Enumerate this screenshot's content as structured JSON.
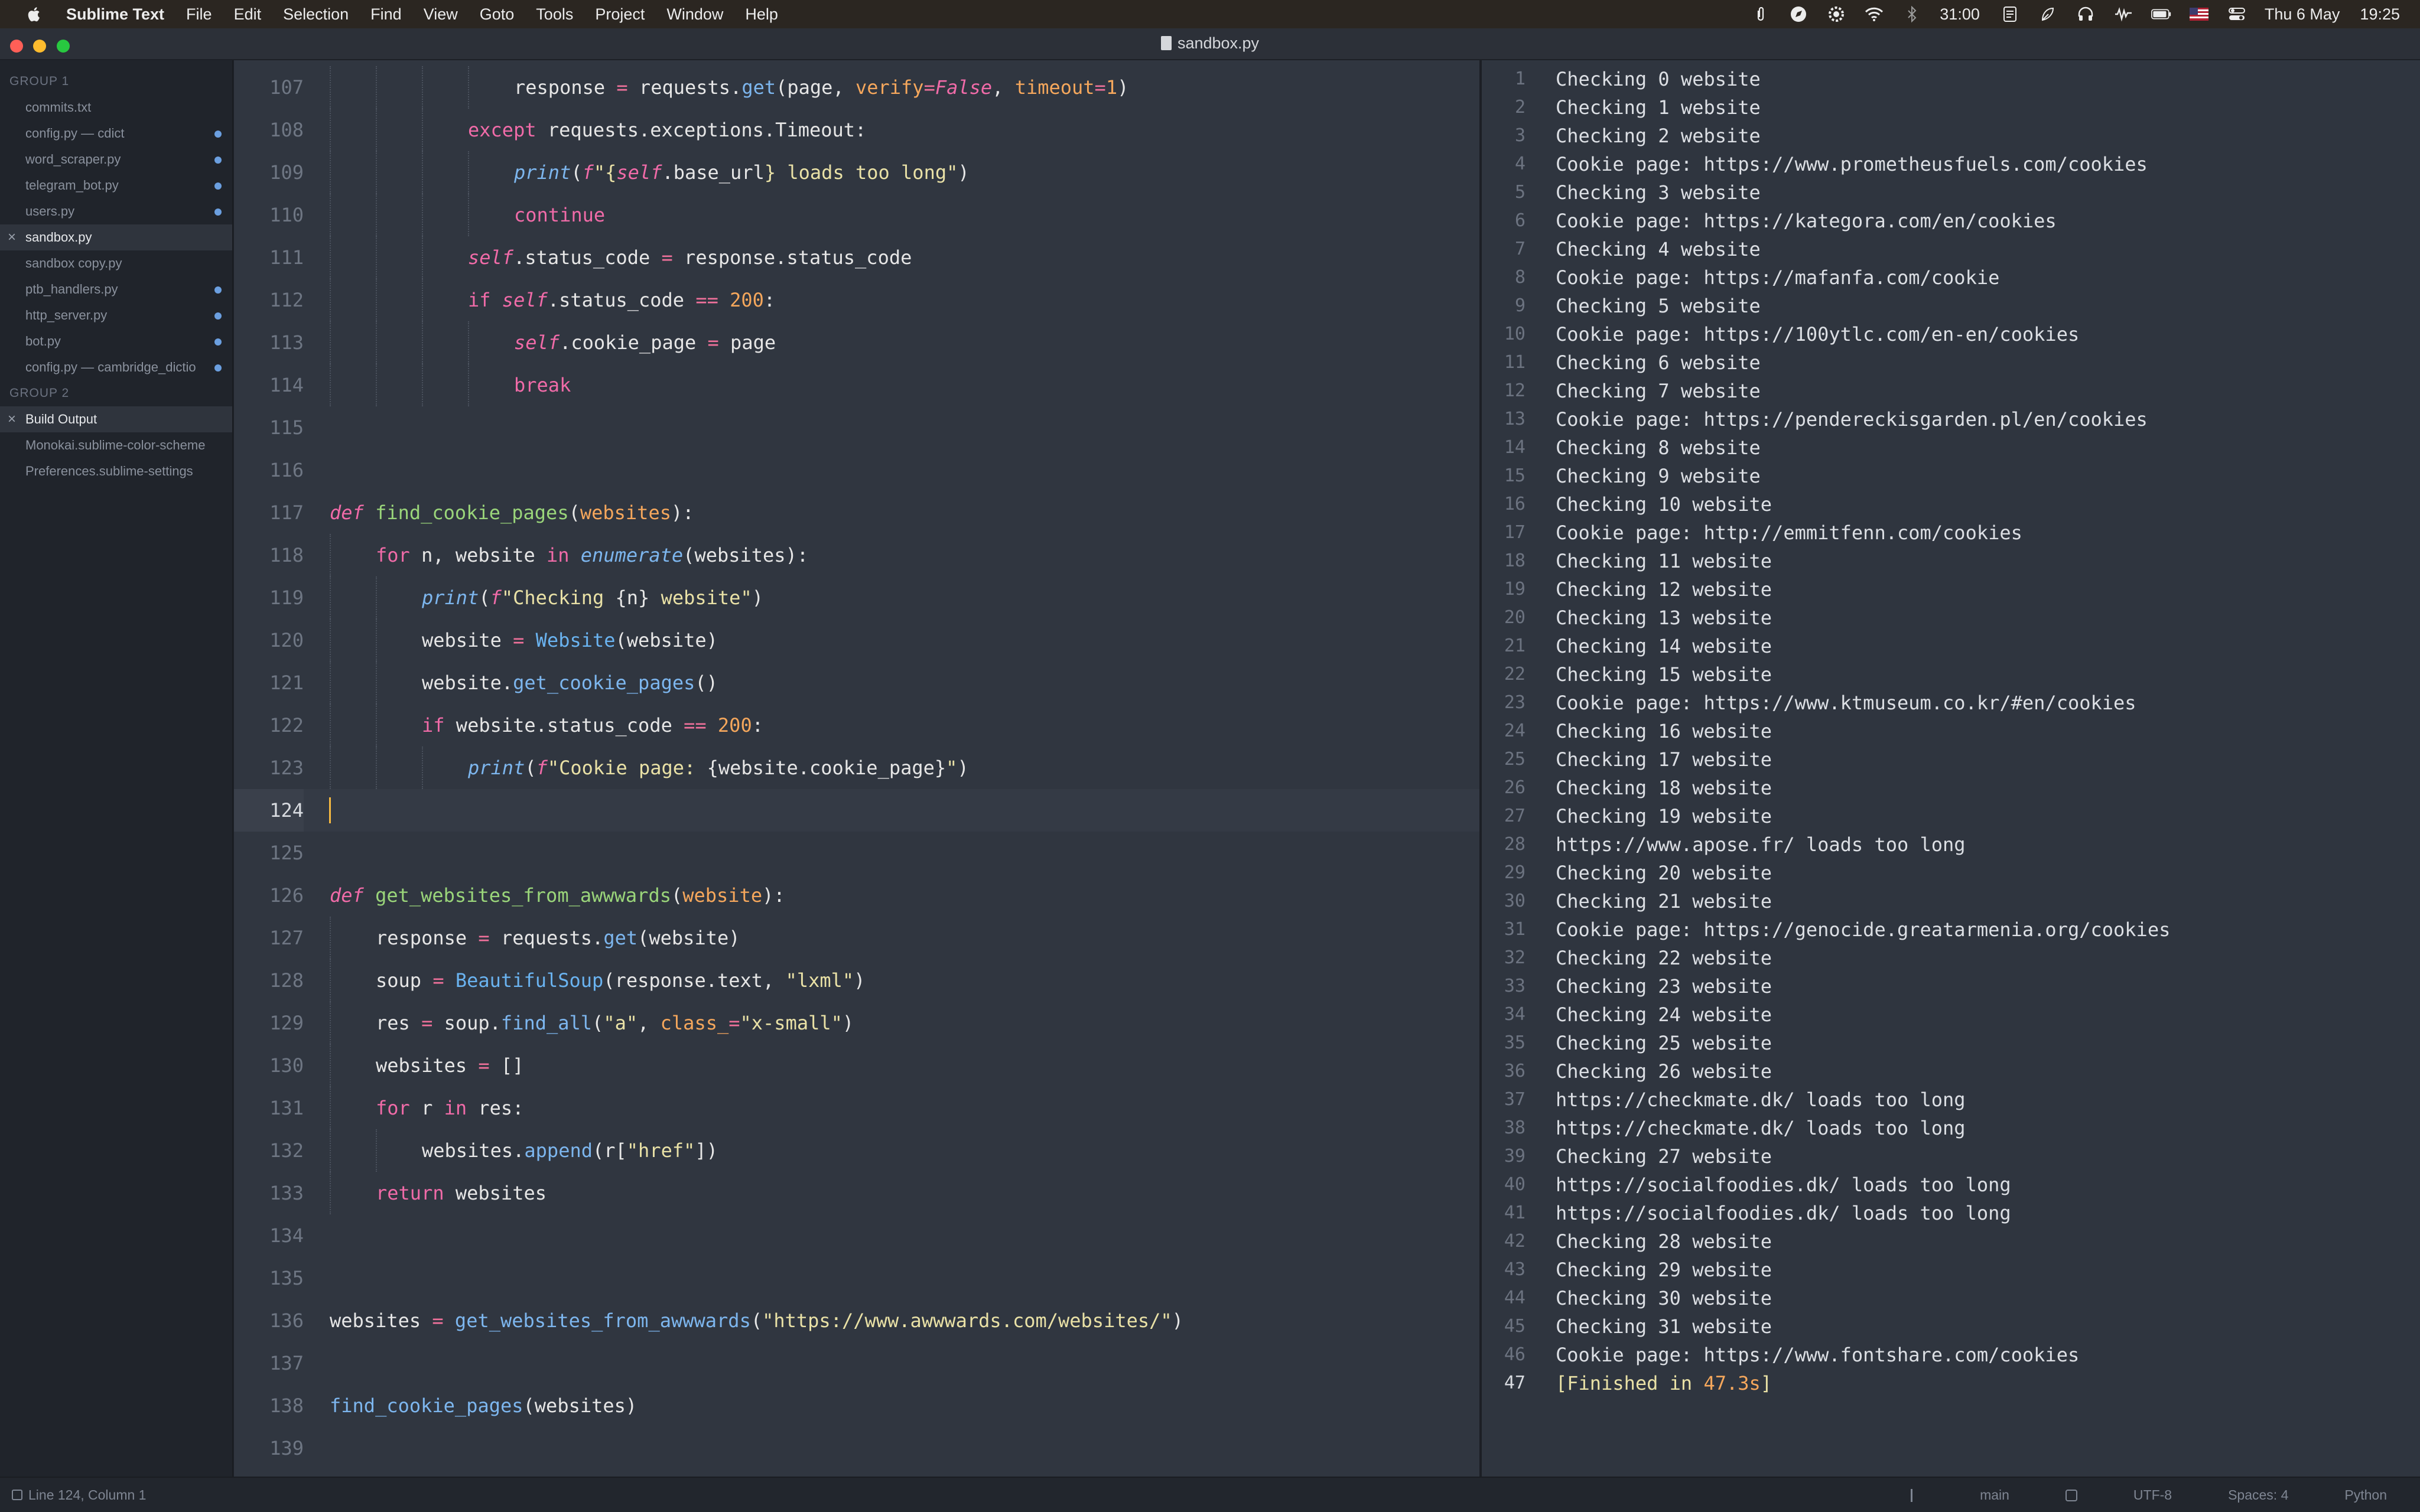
{
  "menubar": {
    "app_name": "Sublime Text",
    "menus": [
      "File",
      "Edit",
      "Selection",
      "Find",
      "View",
      "Goto",
      "Tools",
      "Project",
      "Window",
      "Help"
    ],
    "timer": "31:00",
    "date": "Thu 6 May",
    "time": "19:25",
    "status_icons": [
      "paperclip-icon",
      "compass-icon",
      "gear-badge-icon",
      "wifi-icon",
      "bluetooth-icon",
      "timer-icon",
      "notes-icon",
      "leaf-icon",
      "headphones-icon",
      "waveform-icon",
      "battery-icon",
      "flag-icon",
      "control-center-icon"
    ]
  },
  "window": {
    "title": "sandbox.py"
  },
  "sidebar": {
    "group1_label": "GROUP 1",
    "group1_items": [
      {
        "label": "commits.txt",
        "dot": false,
        "active": false,
        "closable": false
      },
      {
        "label": "config.py — cdict",
        "dot": true,
        "active": false,
        "closable": false
      },
      {
        "label": "word_scraper.py",
        "dot": true,
        "active": false,
        "closable": false
      },
      {
        "label": "telegram_bot.py",
        "dot": true,
        "active": false,
        "closable": false
      },
      {
        "label": "users.py",
        "dot": true,
        "active": false,
        "closable": false
      },
      {
        "label": "sandbox.py",
        "dot": false,
        "active": true,
        "closable": true
      },
      {
        "label": "sandbox copy.py",
        "dot": false,
        "active": false,
        "closable": false
      },
      {
        "label": "ptb_handlers.py",
        "dot": true,
        "active": false,
        "closable": false
      },
      {
        "label": "http_server.py",
        "dot": true,
        "active": false,
        "closable": false
      },
      {
        "label": "bot.py",
        "dot": true,
        "active": false,
        "closable": false
      },
      {
        "label": "config.py — cambridge_dictio",
        "dot": true,
        "active": false,
        "closable": false
      }
    ],
    "group2_label": "GROUP 2",
    "group2_items": [
      {
        "label": "Build Output",
        "dot": false,
        "active": true,
        "closable": true
      },
      {
        "label": "Monokai.sublime-color-scheme",
        "dot": false,
        "active": false,
        "closable": false
      },
      {
        "label": "Preferences.sublime-settings",
        "dot": false,
        "active": false,
        "closable": false
      }
    ]
  },
  "editor": {
    "current_line": 124,
    "lines": [
      {
        "n": "107",
        "indent": 4,
        "tokens": [
          [
            "pl",
            "response "
          ],
          [
            "op",
            "="
          ],
          [
            "pl",
            " requests."
          ],
          [
            "ac",
            "get"
          ],
          [
            "pl",
            "(page, "
          ],
          [
            "pm",
            "verify"
          ],
          [
            "op",
            "="
          ],
          [
            "fal",
            "False"
          ],
          [
            "pl",
            ", "
          ],
          [
            "pm",
            "timeout"
          ],
          [
            "op",
            "="
          ],
          [
            "num",
            "1"
          ],
          [
            "pl",
            ")"
          ]
        ]
      },
      {
        "n": "108",
        "indent": 3,
        "tokens": [
          [
            "kw",
            "except"
          ],
          [
            "pl",
            " requests.exceptions.Timeout:"
          ]
        ]
      },
      {
        "n": "109",
        "indent": 4,
        "tokens": [
          [
            "bii",
            "print"
          ],
          [
            "pl",
            "("
          ],
          [
            "kwi",
            "f"
          ],
          [
            "st",
            "\"{"
          ],
          [
            "sf",
            "self"
          ],
          [
            "pl",
            ".base_url"
          ],
          [
            "st",
            "} loads too long\""
          ],
          [
            "pl",
            ")"
          ]
        ]
      },
      {
        "n": "110",
        "indent": 4,
        "tokens": [
          [
            "kw",
            "continue"
          ]
        ]
      },
      {
        "n": "111",
        "indent": 3,
        "tokens": [
          [
            "sf",
            "self"
          ],
          [
            "pl",
            ".status_code "
          ],
          [
            "op",
            "="
          ],
          [
            "pl",
            " response.status_code"
          ]
        ]
      },
      {
        "n": "112",
        "indent": 3,
        "tokens": [
          [
            "kw",
            "if "
          ],
          [
            "sf",
            "self"
          ],
          [
            "pl",
            ".status_code "
          ],
          [
            "op",
            "=="
          ],
          [
            "pl",
            " "
          ],
          [
            "num",
            "200"
          ],
          [
            "pl",
            ":"
          ]
        ]
      },
      {
        "n": "113",
        "indent": 4,
        "tokens": [
          [
            "sf",
            "self"
          ],
          [
            "pl",
            ".cookie_page "
          ],
          [
            "op",
            "="
          ],
          [
            "pl",
            " page"
          ]
        ]
      },
      {
        "n": "114",
        "indent": 4,
        "tokens": [
          [
            "kw",
            "break"
          ]
        ]
      },
      {
        "n": "115",
        "indent": 0,
        "tokens": []
      },
      {
        "n": "116",
        "indent": 0,
        "tokens": []
      },
      {
        "n": "117",
        "indent": 0,
        "tokens": [
          [
            "kwi",
            "def"
          ],
          [
            "pl",
            " "
          ],
          [
            "fn",
            "find_cookie_pages"
          ],
          [
            "pl",
            "("
          ],
          [
            "pm",
            "websites"
          ],
          [
            "pl",
            "):"
          ]
        ]
      },
      {
        "n": "118",
        "indent": 1,
        "tokens": [
          [
            "kw",
            "for"
          ],
          [
            "pl",
            " n, website "
          ],
          [
            "kw",
            "in"
          ],
          [
            "pl",
            " "
          ],
          [
            "bii",
            "enumerate"
          ],
          [
            "pl",
            "(websites):"
          ]
        ]
      },
      {
        "n": "119",
        "indent": 2,
        "tokens": [
          [
            "bii",
            "print"
          ],
          [
            "pl",
            "("
          ],
          [
            "kwi",
            "f"
          ],
          [
            "st",
            "\"Checking "
          ],
          [
            "pl",
            "{n}"
          ],
          [
            "st",
            " website\""
          ],
          [
            "pl",
            ")"
          ]
        ]
      },
      {
        "n": "120",
        "indent": 2,
        "tokens": [
          [
            "pl",
            "website "
          ],
          [
            "op",
            "="
          ],
          [
            "pl",
            " "
          ],
          [
            "cls",
            "Website"
          ],
          [
            "pl",
            "(website)"
          ]
        ]
      },
      {
        "n": "121",
        "indent": 2,
        "tokens": [
          [
            "pl",
            "website."
          ],
          [
            "ac",
            "get_cookie_pages"
          ],
          [
            "pl",
            "()"
          ]
        ]
      },
      {
        "n": "122",
        "indent": 2,
        "tokens": [
          [
            "kw",
            "if"
          ],
          [
            "pl",
            " website.status_code "
          ],
          [
            "op",
            "=="
          ],
          [
            "pl",
            " "
          ],
          [
            "num",
            "200"
          ],
          [
            "pl",
            ":"
          ]
        ]
      },
      {
        "n": "123",
        "indent": 3,
        "tokens": [
          [
            "bii",
            "print"
          ],
          [
            "pl",
            "("
          ],
          [
            "kwi",
            "f"
          ],
          [
            "st",
            "\"Cookie page: "
          ],
          [
            "pl",
            "{website.cookie_page}"
          ],
          [
            "st",
            "\""
          ],
          [
            "pl",
            ")"
          ]
        ]
      },
      {
        "n": "124",
        "indent": 0,
        "tokens": [],
        "current": true
      },
      {
        "n": "125",
        "indent": 0,
        "tokens": []
      },
      {
        "n": "126",
        "indent": 0,
        "tokens": [
          [
            "kwi",
            "def"
          ],
          [
            "pl",
            " "
          ],
          [
            "fn",
            "get_websites_from_awwwards"
          ],
          [
            "pl",
            "("
          ],
          [
            "pm",
            "website"
          ],
          [
            "pl",
            "):"
          ]
        ]
      },
      {
        "n": "127",
        "indent": 1,
        "tokens": [
          [
            "pl",
            "response "
          ],
          [
            "op",
            "="
          ],
          [
            "pl",
            " requests."
          ],
          [
            "ac",
            "get"
          ],
          [
            "pl",
            "(website)"
          ]
        ]
      },
      {
        "n": "128",
        "indent": 1,
        "tokens": [
          [
            "pl",
            "soup "
          ],
          [
            "op",
            "="
          ],
          [
            "pl",
            " "
          ],
          [
            "cls",
            "BeautifulSoup"
          ],
          [
            "pl",
            "(response.text, "
          ],
          [
            "st",
            "\"lxml\""
          ],
          [
            "pl",
            ")"
          ]
        ]
      },
      {
        "n": "129",
        "indent": 1,
        "tokens": [
          [
            "pl",
            "res "
          ],
          [
            "op",
            "="
          ],
          [
            "pl",
            " soup."
          ],
          [
            "ac",
            "find_all"
          ],
          [
            "pl",
            "("
          ],
          [
            "st",
            "\"a\""
          ],
          [
            "pl",
            ", "
          ],
          [
            "pm",
            "class_"
          ],
          [
            "op",
            "="
          ],
          [
            "st",
            "\"x-small\""
          ],
          [
            "pl",
            ")"
          ]
        ]
      },
      {
        "n": "130",
        "indent": 1,
        "tokens": [
          [
            "pl",
            "websites "
          ],
          [
            "op",
            "="
          ],
          [
            "pl",
            " []"
          ]
        ]
      },
      {
        "n": "131",
        "indent": 1,
        "tokens": [
          [
            "kw",
            "for"
          ],
          [
            "pl",
            " r "
          ],
          [
            "kw",
            "in"
          ],
          [
            "pl",
            " res:"
          ]
        ]
      },
      {
        "n": "132",
        "indent": 2,
        "tokens": [
          [
            "pl",
            "websites."
          ],
          [
            "ac",
            "append"
          ],
          [
            "pl",
            "(r["
          ],
          [
            "st",
            "\"href\""
          ],
          [
            "pl",
            "])"
          ]
        ]
      },
      {
        "n": "133",
        "indent": 1,
        "tokens": [
          [
            "kw",
            "return"
          ],
          [
            "pl",
            " websites"
          ]
        ]
      },
      {
        "n": "134",
        "indent": 0,
        "tokens": []
      },
      {
        "n": "135",
        "indent": 0,
        "tokens": []
      },
      {
        "n": "136",
        "indent": 0,
        "tokens": [
          [
            "pl",
            "websites "
          ],
          [
            "op",
            "="
          ],
          [
            "pl",
            " "
          ],
          [
            "ac",
            "get_websites_from_awwwards"
          ],
          [
            "pl",
            "("
          ],
          [
            "st",
            "\"https://www.awwwards.com/websites/\""
          ],
          [
            "pl",
            ")"
          ]
        ]
      },
      {
        "n": "137",
        "indent": 0,
        "tokens": []
      },
      {
        "n": "138",
        "indent": 0,
        "tokens": [
          [
            "ac",
            "find_cookie_pages"
          ],
          [
            "pl",
            "(websites)"
          ]
        ]
      },
      {
        "n": "139",
        "indent": 0,
        "tokens": []
      }
    ]
  },
  "output": {
    "lines": [
      "Checking 0 website",
      "Checking 1 website",
      "Checking 2 website",
      "Cookie page: https://www.prometheusfuels.com/cookies",
      "Checking 3 website",
      "Cookie page: https://kategora.com/en/cookies",
      "Checking 4 website",
      "Cookie page: https://mafanfa.com/cookie",
      "Checking 5 website",
      "Cookie page: https://100ytlc.com/en-en/cookies",
      "Checking 6 website",
      "Checking 7 website",
      "Cookie page: https://pendereckisgarden.pl/en/cookies",
      "Checking 8 website",
      "Checking 9 website",
      "Checking 10 website",
      "Cookie page: http://emmitfenn.com/cookies",
      "Checking 11 website",
      "Checking 12 website",
      "Checking 13 website",
      "Checking 14 website",
      "Checking 15 website",
      "Cookie page: https://www.ktmuseum.co.kr/#en/cookies",
      "Checking 16 website",
      "Checking 17 website",
      "Checking 18 website",
      "Checking 19 website",
      "https://www.apose.fr/ loads too long",
      "Checking 20 website",
      "Checking 21 website",
      "Cookie page: https://genocide.greatarmenia.org/cookies",
      "Checking 22 website",
      "Checking 23 website",
      "Checking 24 website",
      "Checking 25 website",
      "Checking 26 website",
      "https://checkmate.dk/ loads too long",
      "https://checkmate.dk/ loads too long",
      "Checking 27 website",
      "https://socialfoodies.dk/ loads too long",
      "https://socialfoodies.dk/ loads too long",
      "Checking 28 website",
      "Checking 29 website",
      "Checking 30 website",
      "Checking 31 website",
      "Cookie page: https://www.fontshare.com/cookies"
    ],
    "finished": {
      "open": "[Finished in ",
      "time": "47.3s",
      "close": "]"
    }
  },
  "statusbar": {
    "position": "Line 124, Column 1",
    "branch": "main",
    "encoding": "UTF-8",
    "indentation": "Spaces: 4",
    "syntax": "Python"
  },
  "colors": {
    "menubar_bg": "#2b2621",
    "sidebar_bg": "#20242b",
    "editor_bg": "#303640",
    "output_bg": "#2f353f",
    "caret": "#f5b942"
  }
}
